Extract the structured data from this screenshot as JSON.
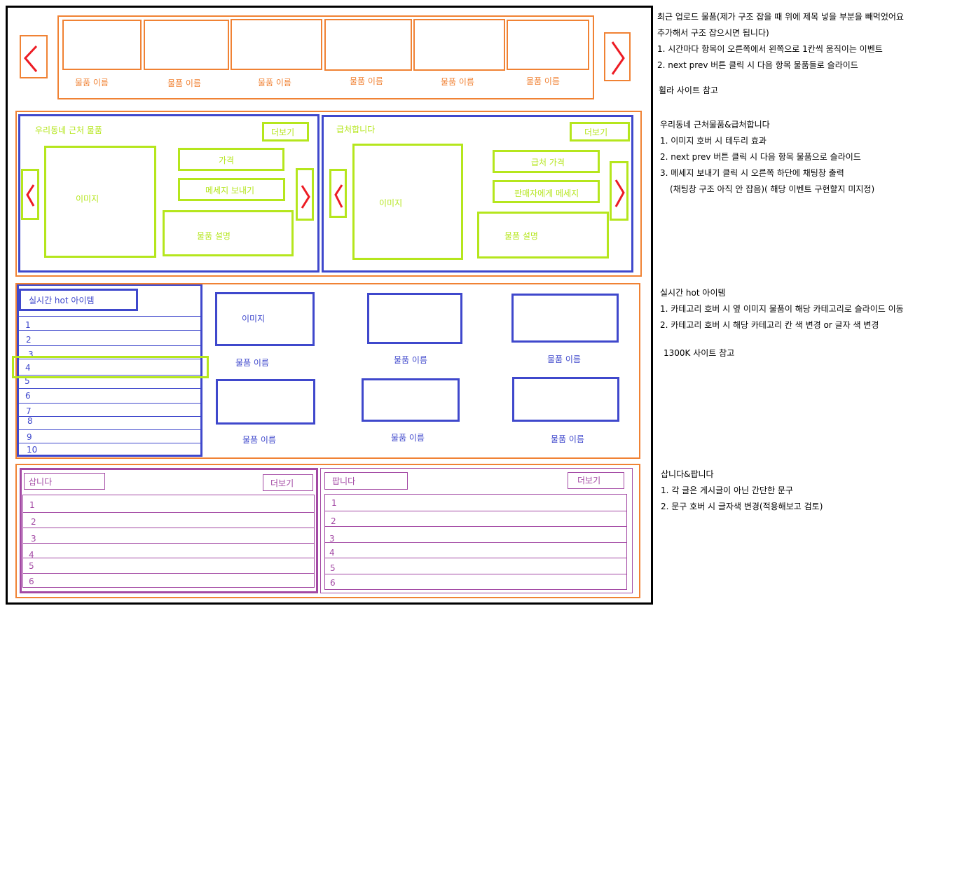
{
  "recent": {
    "item_labels": [
      "물품 이름",
      "물품 이름",
      "물품 이름",
      "물품 이름",
      "물품 이름",
      "물품 이름"
    ]
  },
  "nearby": {
    "title": "우리동네 근처 물품",
    "more": "더보기",
    "price": "가격",
    "send_message": "메세지 보내기",
    "image": "이미지",
    "description": "물품 설명"
  },
  "urgent": {
    "title": "급처합니다",
    "more": "더보기",
    "price": "급처 가격",
    "send_message": "판매자에게 메세지",
    "image": "이미지",
    "description": "물품 설명"
  },
  "hot": {
    "title": "실시간 hot 아이템",
    "ranks": [
      "1",
      "2",
      "3",
      "4",
      "5",
      "6",
      "7",
      "8",
      "9",
      "10"
    ],
    "image": "이미지",
    "item_labels": [
      "물품 이름",
      "물품 이름",
      "물품 이름",
      "물품 이름",
      "물품 이름",
      "물품 이름"
    ]
  },
  "buy": {
    "title": "삽니다",
    "more": "더보기",
    "rows": [
      "1",
      "2",
      "3",
      "4",
      "5",
      "6"
    ]
  },
  "sell": {
    "title": "팝니다",
    "more": "더보기",
    "rows": [
      "1",
      "2",
      "3",
      "4",
      "5",
      "6"
    ]
  },
  "notes": {
    "recent": [
      "최근 업로드 물품(제가 구조 잡을 때 위에 제목 넣을 부분을 빼먹었어요",
      "추가해서 구조 잡으시면 됩니다)",
      "1. 시간마다 항목이 오른쪽에서 왼쪽으로 1칸씩 움직이는 이벤트",
      "2. next prev 버튼 클릭 시 다음 항목 물품들로 슬라이드",
      "휠라 사이트 참고"
    ],
    "nearby": [
      "우리동네 근처물품&급처합니다",
      "1. 이미지 호버 시 테두리 효과",
      "2. next prev 버튼 클릭 시 다음 항목 물품으로 슬라이드",
      "3. 메세지 보내기 클릭 시 오른쪽 하단에 채팅창 출력",
      "(채팅창 구조 아직 안 잡음)( 해당 이벤트 구현할지 미지정)"
    ],
    "hot": [
      "실시간 hot 아이템",
      "1. 카테고리 호버 시 옆 이미지 물품이 해당 카테고리로 슬라이드 이동",
      "2. 카테고리 호버 시 해당 카테고리 칸 색 변경 or 글자 색 변경",
      "1300K 사이트 참고"
    ],
    "buysell": [
      "삽니다&팝니다",
      "1. 각 글은 게시글이 아닌 간단한 문구",
      "2. 문구 호버 시 글자색 변경(적용해보고 검토)"
    ]
  },
  "colors": {
    "orange": "#f08234",
    "blue": "#3f48cc",
    "green": "#b5e61d",
    "purple": "#a349a4",
    "arrow_red": "#ed1c24"
  }
}
